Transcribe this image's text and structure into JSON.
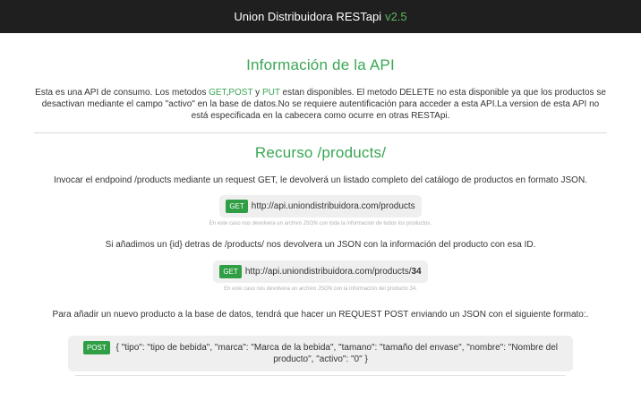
{
  "header": {
    "title": "Union Distribuidora RESTapi",
    "version": "v2.5"
  },
  "info": {
    "heading": "Información de la API",
    "text_1": "Esta es una API de consumo. Los metodos ",
    "get": "GET",
    "comma": ",",
    "post": "POST",
    "and": " y ",
    "put": "PUT",
    "text_2": " estan disponibles. El metodo DELETE no esta disponible ya que los productos se desactivan mediante el campo \"activo\" en la base de datos.No se requiere autentificación para acceder a esta API.La version de esta API no está especificada en la cabecera como ocurre en otras RESTApi."
  },
  "resource": {
    "heading": "Recurso /products/",
    "desc_1": "Invocar el endpoind /products mediante un request GET, le devolverá un listado completo del catálogo de productos en formato JSON.",
    "ex1": {
      "method": "GET",
      "url": "http://api.uniondistribuidora.com/products"
    },
    "note_1": "En este caso nos devolvera un archivo JSON con toda la informacion de todos los productos.",
    "desc_2": "Si añadimos un {id} detras de /products/ nos devolvera un JSON con la información del producto con esa ID.",
    "ex2": {
      "method": "GET",
      "url": "http://api.uniondistribuidora.com/products/",
      "id": "34"
    },
    "note_2": "En este caso nos devolvera un archivo JSON con la información del producto 34.",
    "desc_3": "Para añadir un nuevo producto a la base de datos, tendrá que hacer un REQUEST POST enviando un JSON con el siguiente formato:.",
    "ex3": {
      "method": "POST",
      "body": "{ \"tipo\": \"tipo de bebida\", \"marca\": \"Marca de la bebida\", \"tamano\": \"tamaño del envase\", \"nombre\": \"Nombre del producto\", \"activo\": \"0\" }"
    }
  }
}
